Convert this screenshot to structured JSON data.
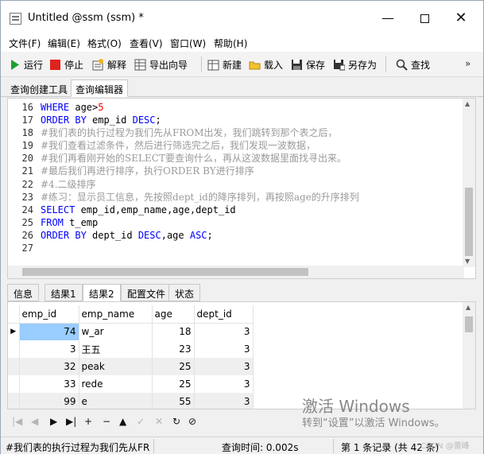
{
  "window": {
    "title": "Untitled @ssm (ssm) *",
    "minimize": "—",
    "close": "✕"
  },
  "menu": [
    "文件(F)",
    "编辑(E)",
    "格式(O)",
    "查看(V)",
    "窗口(W)",
    "帮助(H)"
  ],
  "toolbar": {
    "run": "运行",
    "stop": "停止",
    "explain": "解释",
    "export": "导出向导",
    "new": "新建",
    "load": "载入",
    "save": "保存",
    "save_as": "另存为",
    "find": "查找",
    "more": "»"
  },
  "query_tabs": [
    "查询创建工具",
    "查询编辑器"
  ],
  "editor": {
    "lines": [
      {
        "n": "16",
        "parts": [
          [
            "kw",
            "WHERE"
          ],
          [
            "t",
            " age>"
          ],
          [
            "num",
            "5"
          ]
        ]
      },
      {
        "n": "17",
        "parts": [
          [
            "kw",
            "ORDER BY"
          ],
          [
            "t",
            " emp_id "
          ],
          [
            "kw",
            "DESC"
          ],
          [
            "t",
            ";"
          ]
        ]
      },
      {
        "n": "18",
        "parts": [
          [
            "cm",
            "#我们表的执行过程为我们先从FROM出发，我们跳转到那个表之后，"
          ]
        ]
      },
      {
        "n": "19",
        "parts": [
          [
            "cm",
            "#我们查看过滤条件，然后进行筛选完之后，我们发现一波数据，"
          ]
        ]
      },
      {
        "n": "20",
        "parts": [
          [
            "cm",
            "#我们再看刚开始的SELECT要查询什么，再从这波数据里面找寻出来。"
          ]
        ]
      },
      {
        "n": "21",
        "parts": [
          [
            "cm",
            "#最后我们再进行排序，执行ORDER BY进行排序"
          ]
        ]
      },
      {
        "n": "22",
        "parts": [
          [
            "cm",
            "#4.二级排序"
          ]
        ]
      },
      {
        "n": "23",
        "parts": [
          [
            "cm",
            "#练习：显示员工信息，先按照dept_id的降序排列，再按照age的升序排列"
          ]
        ]
      },
      {
        "n": "24",
        "parts": [
          [
            "kw",
            "SELECT"
          ],
          [
            "t",
            " emp_id,emp_name,age,dept_id"
          ]
        ]
      },
      {
        "n": "25",
        "parts": [
          [
            "kw",
            "FROM"
          ],
          [
            "t",
            " t_emp"
          ]
        ]
      },
      {
        "n": "26",
        "parts": [
          [
            "kw",
            "ORDER BY"
          ],
          [
            "t",
            " dept_id "
          ],
          [
            "kw",
            "DESC"
          ],
          [
            "t",
            ",age "
          ],
          [
            "kw",
            "ASC"
          ],
          [
            "t",
            ";"
          ]
        ]
      },
      {
        "n": "27",
        "parts": []
      }
    ]
  },
  "result_tabs": [
    "信息",
    "结果1",
    "结果2",
    "配置文件",
    "状态"
  ],
  "grid": {
    "columns": [
      "emp_id",
      "emp_name",
      "age",
      "dept_id"
    ],
    "rows": [
      [
        "74",
        "w_ar",
        "18",
        "3"
      ],
      [
        "3",
        "王五",
        "23",
        "3"
      ],
      [
        "32",
        "peak",
        "25",
        "3"
      ],
      [
        "33",
        "rede",
        "25",
        "3"
      ],
      [
        "99",
        "e",
        "55",
        "3"
      ]
    ],
    "current_row_marker": "▶"
  },
  "watermark": {
    "line1": "激活 Windows",
    "line2": "转到“设置”以激活 Windows。"
  },
  "nav_buttons": [
    "|◀",
    "◀",
    "▶",
    "▶|",
    "+",
    "−",
    "▲",
    "✓",
    "✕",
    "↻",
    "⊘"
  ],
  "status": {
    "sql": "#我们表的执行过程为我们先从FROM出发",
    "query_time": "查询时间: 0.002s",
    "records": "第 1 条记录 (共 42 条)",
    "credit": "CSDN @蕾峰"
  },
  "colors": {
    "keyword": "#0000ff",
    "comment": "#9a9a9a",
    "number": "#ff0000",
    "selected_cell": "#99ccff"
  }
}
